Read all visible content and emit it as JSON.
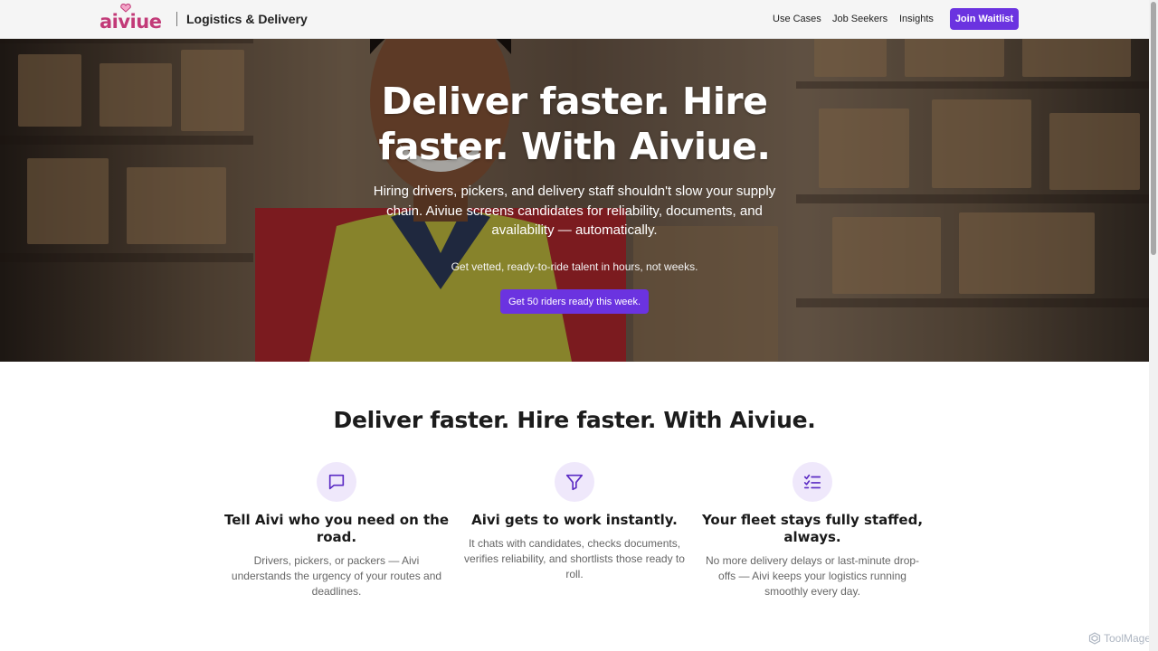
{
  "nav": {
    "logo_text": "aiviue",
    "tagline": "Logistics & Delivery",
    "links": [
      "Use Cases",
      "Job Seekers",
      "Insights"
    ],
    "cta": "Join Waitlist"
  },
  "hero": {
    "title": "Deliver faster. Hire faster. With Aiviue.",
    "description": "Hiring drivers, pickers, and delivery staff shouldn't slow your supply chain. Aiviue screens candidates for reliability, documents, and availability — automatically.",
    "subtext": "Get vetted, ready-to-ride talent in hours, not weeks.",
    "cta": "Get 50 riders ready this week."
  },
  "section": {
    "title": "Deliver faster. Hire faster. With Aiviue.",
    "features": [
      {
        "icon": "chat-icon",
        "title": "Tell Aivi who you need on the road.",
        "text": "Drivers, pickers, or packers — Aivi understands the urgency of your routes and deadlines."
      },
      {
        "icon": "filter-icon",
        "title": "Aivi gets to work instantly.",
        "text": "It chats with candidates, checks documents, verifies reliability, and shortlists those ready to roll."
      },
      {
        "icon": "checklist-icon",
        "title": "Your fleet stays fully staffed, always.",
        "text": "No more delivery delays or last-minute drop-offs — Aivi keeps your logistics running smoothly every day."
      }
    ]
  },
  "watermark": "ToolMage",
  "colors": {
    "accent": "#6b33e0",
    "brand": "#c23a78",
    "icon_bg": "#efe8fb"
  }
}
